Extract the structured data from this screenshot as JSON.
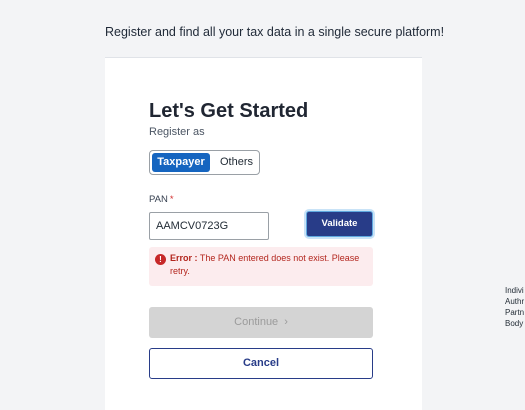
{
  "header": {
    "tagline": "Register and find all your tax data in a single secure platform!"
  },
  "form": {
    "title": "Let's Get Started",
    "subtitle": "Register as",
    "toggle": {
      "active_label": "Taxpayer",
      "inactive_label": "Others"
    },
    "pan": {
      "label": "PAN",
      "required_mark": "*",
      "value": "AAMCV0723G"
    },
    "validate_label": "Validate",
    "error": {
      "icon": "exclamation-circle-icon",
      "prefix": "Error :",
      "message": "The PAN entered does not exist. Please retry."
    },
    "continue_label": "Continue",
    "continue_chevron": "›",
    "cancel_label": "Cancel"
  },
  "side_panel": {
    "items": [
      "Indivi",
      "Authr",
      "Partn",
      "Body"
    ]
  },
  "colors": {
    "primary_blue": "#1565c0",
    "navy": "#283c88",
    "error_red": "#c62828",
    "error_bg": "#fcecee",
    "disabled_gray": "#d4d4d4"
  }
}
